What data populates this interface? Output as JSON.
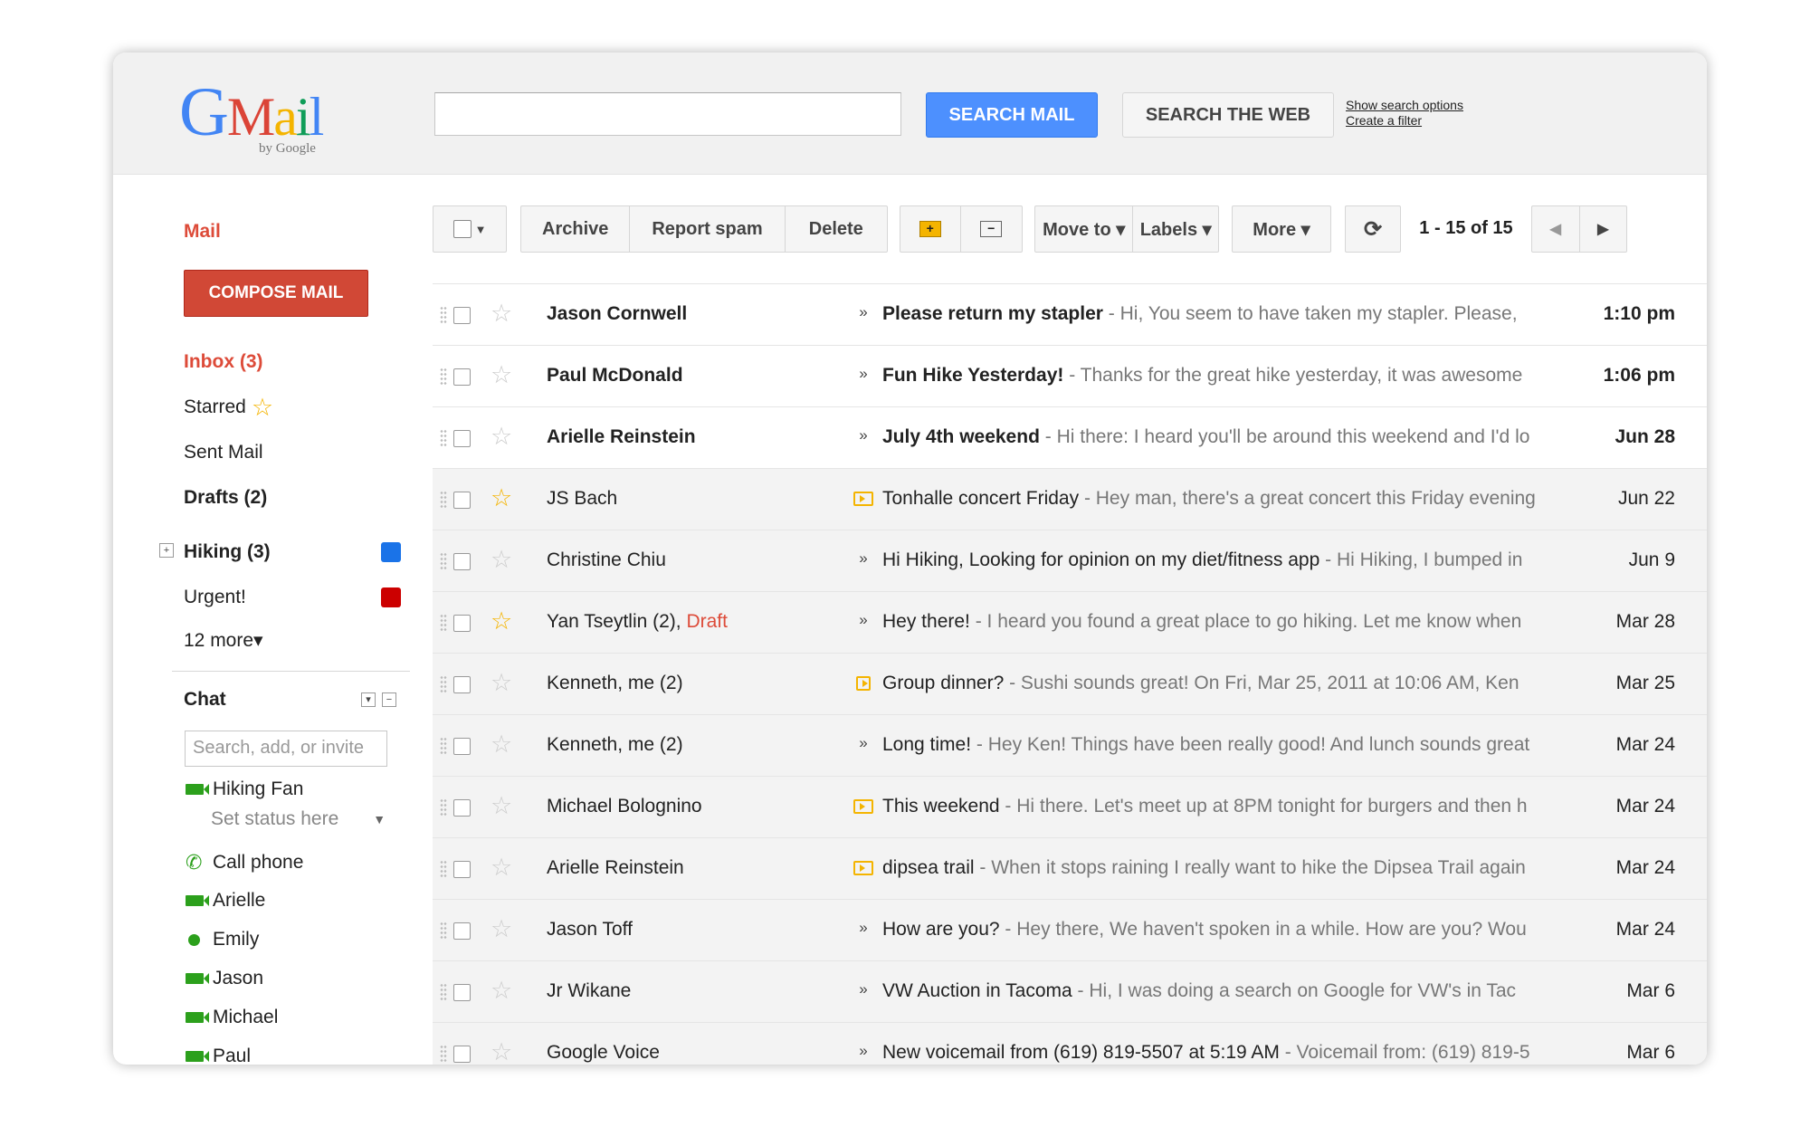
{
  "header": {
    "logo": "Gmail",
    "logo_sub": "by Google",
    "search_value": "",
    "search_mail_label": "SEARCH MAIL",
    "search_web_label": "SEARCH THE WEB",
    "show_search_options": "Show search options",
    "create_filter": "Create a filter"
  },
  "sidebar": {
    "mail_label": "Mail",
    "compose_label": "COMPOSE MAIL",
    "inbox": "Inbox (3)",
    "starred": "Starred",
    "sent": "Sent Mail",
    "drafts": "Drafts (2)",
    "hiking": "Hiking (3)",
    "urgent": "Urgent!",
    "more": "12 more▾",
    "label_colors": {
      "hiking": "#1a73e8",
      "urgent": "#cc0000"
    }
  },
  "chat": {
    "title": "Chat",
    "search_placeholder": "Search, add, or invite",
    "me": "Hiking Fan",
    "status": "Set status here",
    "call_phone": "Call phone",
    "contacts": [
      "Arielle",
      "Emily",
      "Jason",
      "Michael",
      "Paul"
    ]
  },
  "toolbar": {
    "archive": "Archive",
    "report_spam": "Report spam",
    "delete": "Delete",
    "move_to": "Move to ▾",
    "labels": "Labels ▾",
    "more": "More ▾",
    "pagination": "1 - 15 of 15"
  },
  "emails": [
    {
      "sender": "Jason Cornwell",
      "subject": "Please return my stapler",
      "snippet": " - Hi, You seem to have taken my stapler. Please,",
      "date": "1:10 pm"
    },
    {
      "sender": "Paul McDonald",
      "subject": "Fun Hike Yesterday!",
      "snippet": " - Thanks for the great hike yesterday, it was awesome",
      "date": "1:06 pm"
    },
    {
      "sender": "Arielle Reinstein",
      "subject": "July 4th weekend",
      "snippet": " - Hi there: I heard you'll be around this weekend and I'd lo",
      "date": "Jun 28"
    },
    {
      "sender": "JS Bach",
      "subject": "Tonhalle concert Friday",
      "snippet": " - Hey man, there's a great concert this Friday evening",
      "date": "Jun 22"
    },
    {
      "sender": "Christine Chiu",
      "subject": "Hi Hiking, Looking for opinion on my diet/fitness app",
      "snippet": " - Hi Hiking, I bumped in",
      "date": "Jun 9"
    },
    {
      "sender": "Yan Tseytlin (2), ",
      "draft": "Draft",
      "subject": "Hey there!",
      "snippet": " - I heard you found a great place to go hiking. Let me know when",
      "date": "Mar 28"
    },
    {
      "sender": "Kenneth, me (2)",
      "subject": "Group dinner?",
      "snippet": " - Sushi sounds great! On Fri, Mar 25, 2011 at 10:06 AM, Ken",
      "date": "Mar 25"
    },
    {
      "sender": "Kenneth, me (2)",
      "subject": "Long time!",
      "snippet": " - Hey Ken! Things have been really good! And lunch sounds great",
      "date": "Mar 24"
    },
    {
      "sender": "Michael Bolognino",
      "subject": "This weekend",
      "snippet": " - Hi there. Let's meet up at 8PM tonight for burgers and then h",
      "date": "Mar 24"
    },
    {
      "sender": "Arielle Reinstein",
      "subject": "dipsea trail",
      "snippet": " - When it stops raining I really want to hike the Dipsea Trail again",
      "date": "Mar 24"
    },
    {
      "sender": "Jason Toff",
      "subject": "How are you?",
      "snippet": " - Hey there, We haven't spoken in a while. How are you? Wou",
      "date": "Mar 24"
    },
    {
      "sender": "Jr Wikane",
      "subject": "VW Auction in Tacoma",
      "snippet": " - Hi, I was doing a search on Google for VW's in Tac",
      "date": "Mar 6"
    },
    {
      "sender": "Google Voice",
      "subject": "New voicemail from (619) 819-5507 at 5:19 AM",
      "snippet": " - Voicemail from: (619) 819-5",
      "date": "Mar 6"
    }
  ]
}
